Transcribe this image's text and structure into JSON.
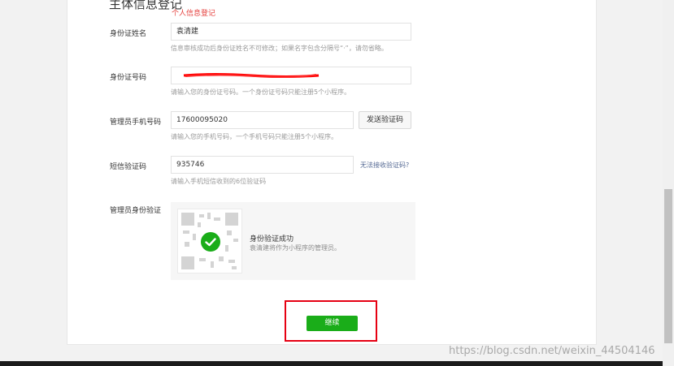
{
  "section": {
    "title": "主体信息登记",
    "note": "个人信息登记"
  },
  "fields": {
    "name": {
      "label": "身份证姓名",
      "value": "袁清建",
      "hint": "信息审核成功后身份证姓名不可修改；如果名字包含分隔号“·”，请勿省略。"
    },
    "id_number": {
      "label": "身份证号码",
      "hint": "请输入您的身份证号码。一个身份证号码只能注册5个小程序。"
    },
    "phone": {
      "label": "管理员手机号码",
      "value": "17600095020",
      "hint": "请输入您的手机号码，一个手机号码只能注册5个小程序。",
      "send_code_label": "发送验证码"
    },
    "sms_code": {
      "label": "短信验证码",
      "value": "935746",
      "hint": "请输入手机短信收到的6位验证码",
      "cannot_receive_label": "无法接收验证码?"
    },
    "admin_verify": {
      "label": "管理员身份验证",
      "status_title": "身份验证成功",
      "status_sub": "袁清建将作为小程序的管理员。"
    }
  },
  "actions": {
    "continue_label": "继续"
  },
  "watermark": "https://blog.csdn.net/weixin_44504146",
  "colors": {
    "primary_green": "#1aad19",
    "link_blue": "#576b95",
    "note_red": "#e64340",
    "frame_red": "#e60012"
  }
}
